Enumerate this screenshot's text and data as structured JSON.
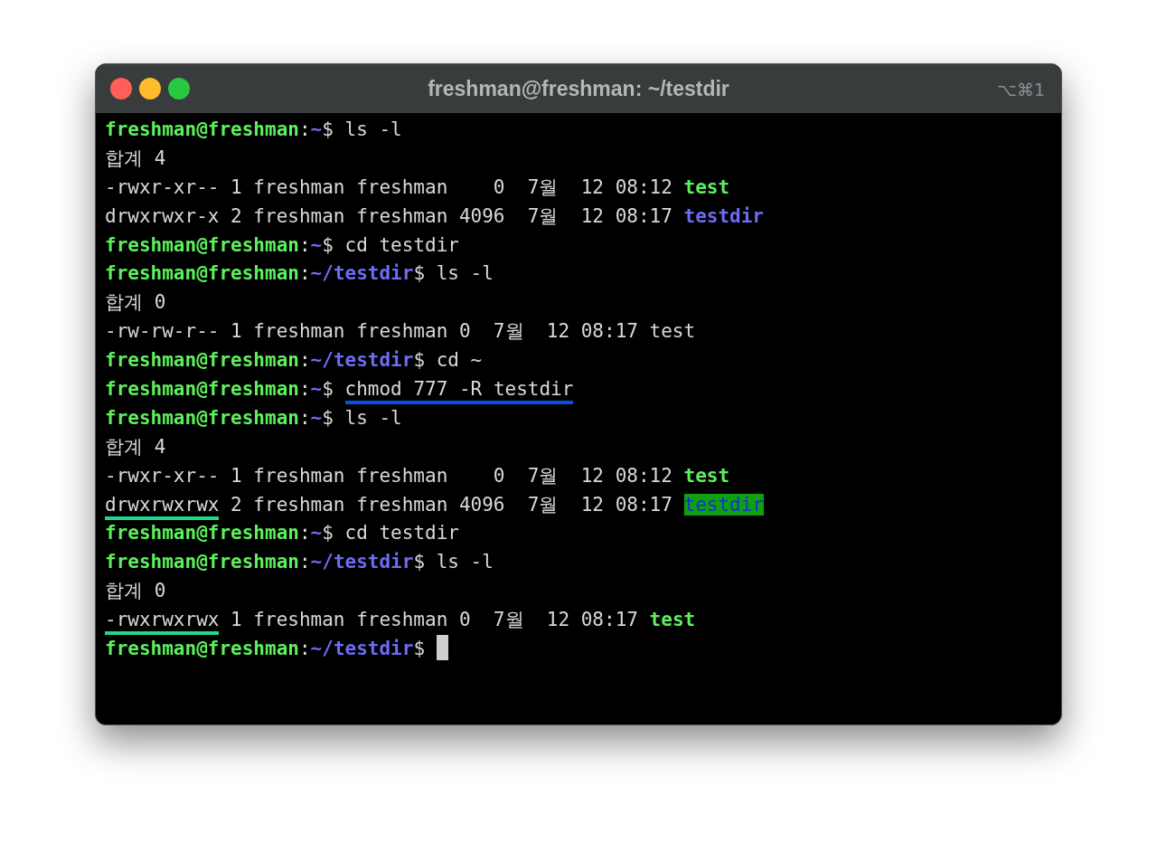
{
  "window": {
    "title": "freshman@freshman: ~/testdir",
    "shortcut": "⌥⌘1"
  },
  "terminal": {
    "cursor": true,
    "lines": [
      {
        "segments": [
          {
            "kind": "user",
            "text": "freshman@freshman"
          },
          {
            "kind": "sep",
            "text": ":"
          },
          {
            "kind": "path",
            "text": "~"
          },
          {
            "kind": "cmd",
            "text": "$ ls -l"
          }
        ]
      },
      {
        "segments": [
          {
            "kind": "plain",
            "text": "합계 4"
          }
        ]
      },
      {
        "segments": [
          {
            "kind": "plain",
            "text": "-rwxr-xr-- 1 freshman freshman    0  7월  12 08:12 "
          },
          {
            "kind": "file",
            "text": "test"
          }
        ]
      },
      {
        "segments": [
          {
            "kind": "plain",
            "text": "drwxrwxr-x 2 freshman freshman 4096  7월  12 08:17 "
          },
          {
            "kind": "dir",
            "text": "testdir"
          }
        ]
      },
      {
        "segments": [
          {
            "kind": "user",
            "text": "freshman@freshman"
          },
          {
            "kind": "sep",
            "text": ":"
          },
          {
            "kind": "path",
            "text": "~"
          },
          {
            "kind": "cmd",
            "text": "$ cd testdir"
          }
        ]
      },
      {
        "segments": [
          {
            "kind": "user",
            "text": "freshman@freshman"
          },
          {
            "kind": "sep",
            "text": ":"
          },
          {
            "kind": "path",
            "text": "~/testdir"
          },
          {
            "kind": "cmd",
            "text": "$ ls -l"
          }
        ]
      },
      {
        "segments": [
          {
            "kind": "plain",
            "text": "합계 0"
          }
        ]
      },
      {
        "segments": [
          {
            "kind": "plain",
            "text": "-rw-rw-r-- 1 freshman freshman 0  7월  12 08:17 test"
          }
        ]
      },
      {
        "segments": [
          {
            "kind": "user",
            "text": "freshman@freshman"
          },
          {
            "kind": "sep",
            "text": ":"
          },
          {
            "kind": "path",
            "text": "~/testdir"
          },
          {
            "kind": "cmd",
            "text": "$ cd ~"
          }
        ]
      },
      {
        "segments": [
          {
            "kind": "user",
            "text": "freshman@freshman"
          },
          {
            "kind": "sep",
            "text": ":"
          },
          {
            "kind": "path",
            "text": "~"
          },
          {
            "kind": "cmd",
            "text": "$ "
          },
          {
            "kind": "cmd",
            "text": "chmod 777 -R testdir",
            "color": "#0a50e6"
          }
        ]
      },
      {
        "segments": [
          {
            "kind": "user",
            "text": "freshman@freshman"
          },
          {
            "kind": "sep",
            "text": ":"
          },
          {
            "kind": "path",
            "text": "~"
          },
          {
            "kind": "cmd",
            "text": "$ ls -l"
          }
        ]
      },
      {
        "segments": [
          {
            "kind": "plain",
            "text": "합계 4"
          }
        ]
      },
      {
        "segments": [
          {
            "kind": "plain",
            "text": "-rwxr-xr-- 1 freshman freshman    0  7월  12 08:12 "
          },
          {
            "kind": "file",
            "text": "test"
          }
        ]
      },
      {
        "segments": [
          {
            "kind": "plain",
            "text": "drwxrwxrwx",
            "color": "#1ed88c"
          },
          {
            "kind": "plain",
            "text": " 2 freshman freshman 4096  7월  12 08:17 "
          },
          {
            "kind": "dir-highlight",
            "text": "testdir"
          }
        ]
      },
      {
        "segments": [
          {
            "kind": "user",
            "text": "freshman@freshman"
          },
          {
            "kind": "sep",
            "text": ":"
          },
          {
            "kind": "path",
            "text": "~"
          },
          {
            "kind": "cmd",
            "text": "$ cd testdir"
          }
        ]
      },
      {
        "segments": [
          {
            "kind": "user",
            "text": "freshman@freshman"
          },
          {
            "kind": "sep",
            "text": ":"
          },
          {
            "kind": "path",
            "text": "~/testdir"
          },
          {
            "kind": "cmd",
            "text": "$ ls -l"
          }
        ]
      },
      {
        "segments": [
          {
            "kind": "plain",
            "text": "합계 0"
          }
        ]
      },
      {
        "segments": [
          {
            "kind": "plain",
            "text": "-rwxrwxrwx",
            "color": "#1ed88c"
          },
          {
            "kind": "plain",
            "text": " 1 freshman freshman 0  7월  12 08:17 "
          },
          {
            "kind": "file",
            "text": "test"
          }
        ]
      },
      {
        "segments": [
          {
            "kind": "user",
            "text": "freshman@freshman"
          },
          {
            "kind": "sep",
            "text": ":"
          },
          {
            "kind": "path",
            "text": "~/testdir"
          },
          {
            "kind": "cmd",
            "text": "$ "
          }
        ]
      }
    ]
  }
}
